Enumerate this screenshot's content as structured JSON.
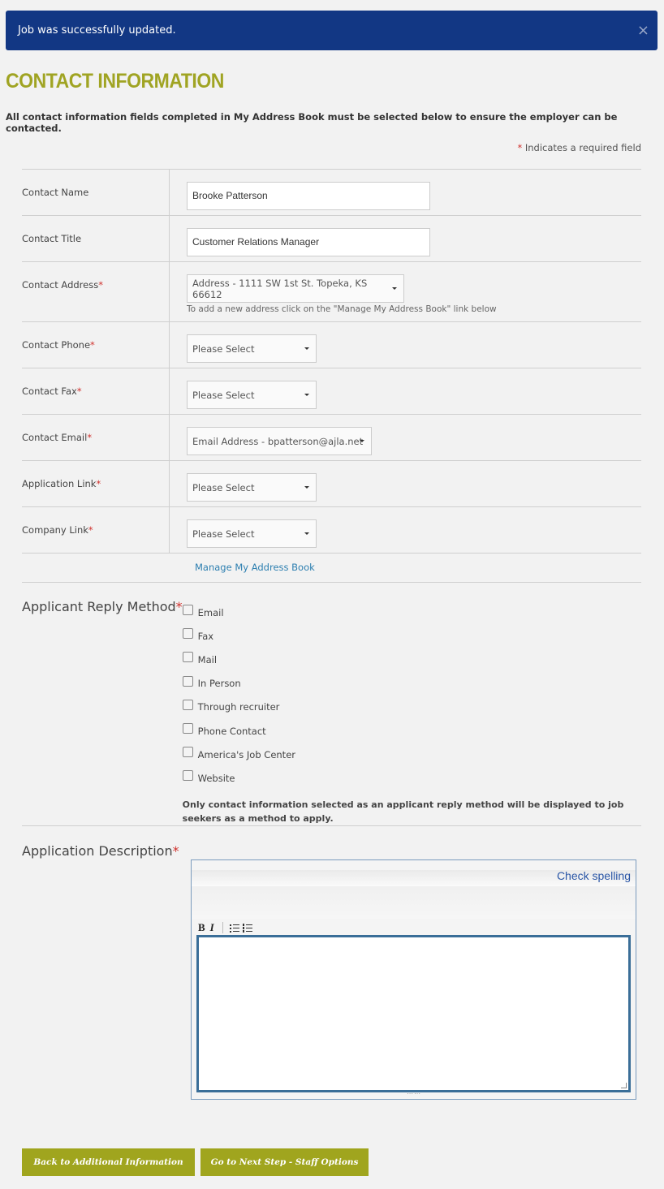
{
  "alert": {
    "message": "Job was successfully updated.",
    "close": "×"
  },
  "page": {
    "title": "CONTACT INFORMATION",
    "intro": "All contact information fields completed in My Address Book must be selected below to ensure the employer can be contacted.",
    "required_star": "*",
    "required_note": "Indicates a required field"
  },
  "fields": {
    "contact_name": {
      "label": "Contact Name",
      "value": "Brooke Patterson"
    },
    "contact_title": {
      "label": "Contact Title",
      "value": "Customer Relations Manager"
    },
    "contact_address": {
      "label": "Contact Address",
      "value": "Address - 1111 SW 1st St. Topeka, KS 66612",
      "hint": "To add a new address click on the \"Manage My Address Book\" link below"
    },
    "contact_phone": {
      "label": "Contact Phone",
      "value": "Please Select"
    },
    "contact_fax": {
      "label": "Contact Fax",
      "value": "Please Select"
    },
    "contact_email": {
      "label": "Contact Email",
      "value": "Email Address - bpatterson@ajla.net"
    },
    "application_link": {
      "label": "Application Link",
      "value": "Please Select"
    },
    "company_link": {
      "label": "Company Link",
      "value": "Please Select"
    }
  },
  "manage_link": "Manage My Address Book",
  "reply": {
    "label": "Applicant Reply Method",
    "options": [
      "Email",
      "Fax",
      "Mail",
      "In Person",
      "Through recruiter",
      "Phone Contact",
      "America's Job Center",
      "Website"
    ],
    "note": "Only contact information selected as an applicant reply method will be displayed to job seekers as a method to apply."
  },
  "description": {
    "label": "Application Description",
    "check_spelling": "Check spelling",
    "bold": "B",
    "italic": "I"
  },
  "buttons": {
    "back": "Back to Additional Information",
    "next": "Go to Next Step - Staff Options"
  },
  "colors": {
    "alert_bg": "#123784",
    "title": "#a0a423",
    "button_bg": "#a0a51e",
    "link": "#2d7fb0",
    "required": "#d0312d"
  }
}
